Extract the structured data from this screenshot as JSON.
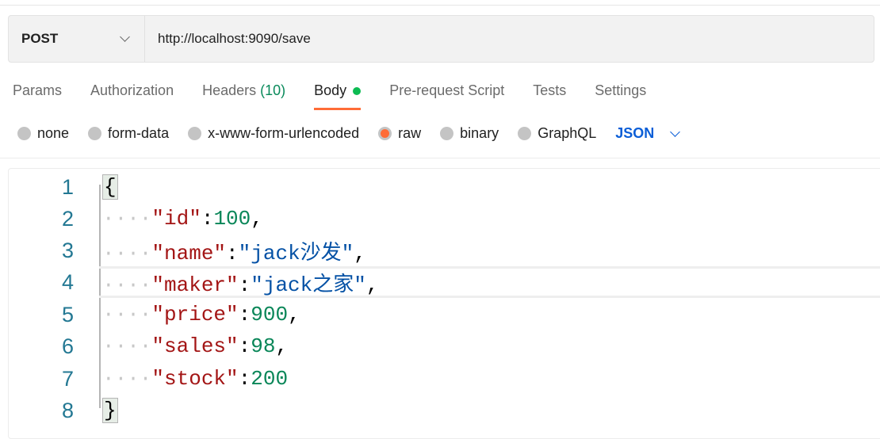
{
  "request": {
    "method": "POST",
    "url": "http://localhost:9090/save"
  },
  "tabs": [
    {
      "label": "Params"
    },
    {
      "label": "Authorization"
    },
    {
      "label": "Headers",
      "count": "(10)"
    },
    {
      "label": "Body",
      "active": true
    },
    {
      "label": "Pre-request Script"
    },
    {
      "label": "Tests"
    },
    {
      "label": "Settings"
    }
  ],
  "body_types": [
    "none",
    "form-data",
    "x-www-form-urlencoded",
    "raw",
    "binary",
    "GraphQL"
  ],
  "selected_body_type": "raw",
  "format": "JSON",
  "editor": {
    "line_numbers": [
      "1",
      "2",
      "3",
      "4",
      "5",
      "6",
      "7",
      "8"
    ],
    "open_brace": "{",
    "close_brace": "}",
    "fields": [
      {
        "key": "\"id\"",
        "value": "100",
        "type": "number",
        "comma": ","
      },
      {
        "key": "\"name\"",
        "value": "\"jack沙发\"",
        "type": "string",
        "comma": ","
      },
      {
        "key": "\"maker\"",
        "value": "\"jack之家\"",
        "type": "string",
        "comma": ","
      },
      {
        "key": "\"price\"",
        "value": "900",
        "type": "number",
        "comma": ","
      },
      {
        "key": "\"sales\"",
        "value": "98",
        "type": "number",
        "comma": ","
      },
      {
        "key": "\"stock\"",
        "value": "200",
        "type": "number",
        "comma": ""
      }
    ]
  },
  "colors": {
    "accent": "#ff6c37",
    "key": "#a31515",
    "number": "#098658",
    "string": "#0451a5",
    "line_number": "#237893",
    "body_dot": "#0cbb52",
    "json_link": "#0b5ed7"
  }
}
